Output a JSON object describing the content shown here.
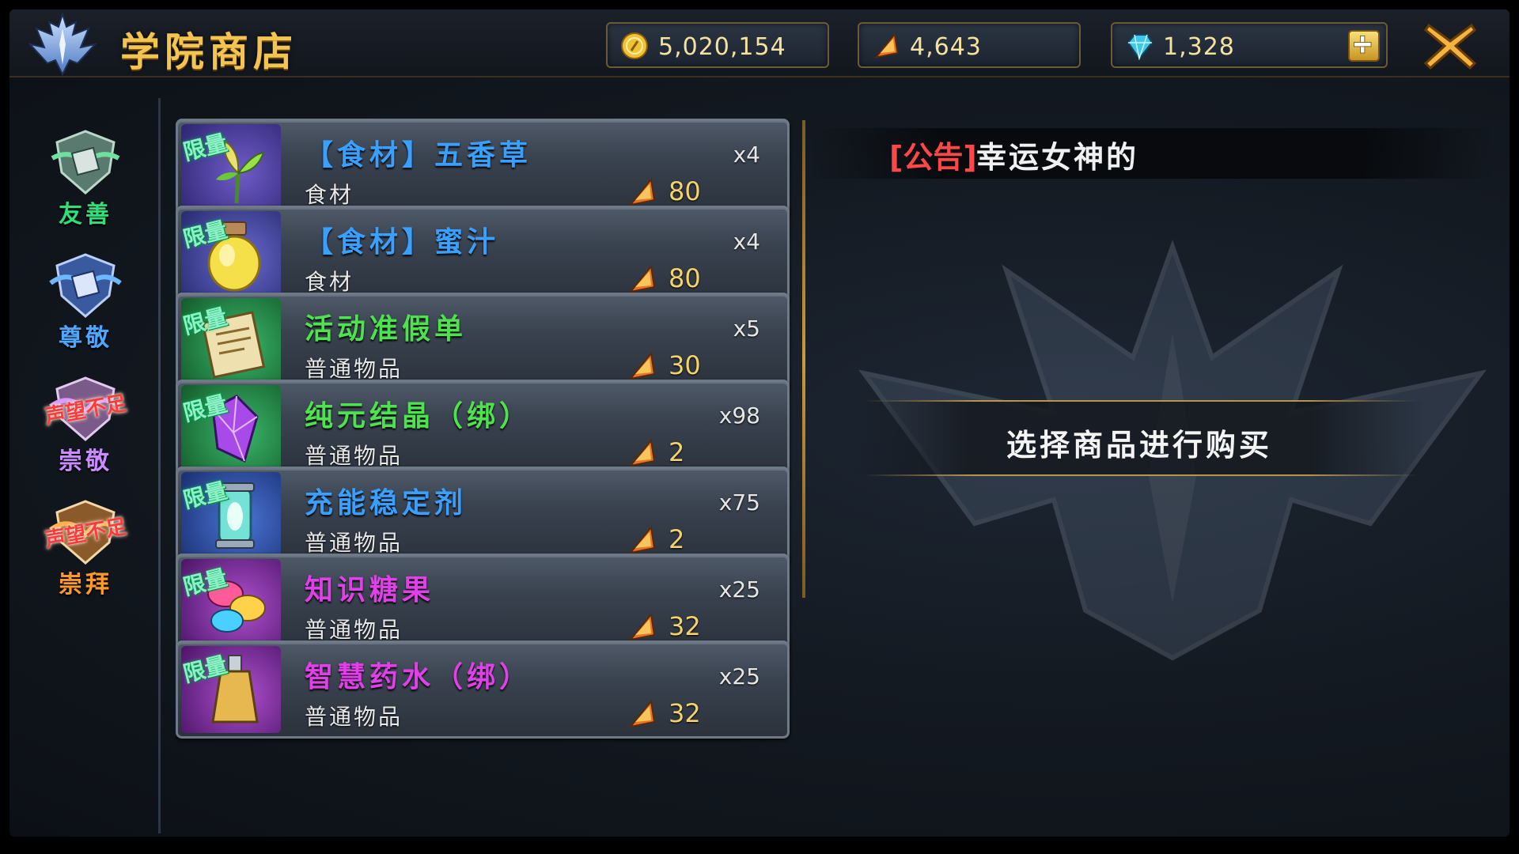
{
  "header": {
    "title": "学院商店",
    "currencies": {
      "gold": "5,020,154",
      "token": "4,643",
      "diamond": "1,328"
    }
  },
  "tabs": [
    {
      "label": "友善",
      "warning": "",
      "color": "#2ee07a"
    },
    {
      "label": "尊敬",
      "warning": "",
      "color": "#4fa6ff"
    },
    {
      "label": "崇敬",
      "warning": "声望不足",
      "color": "#c98bff"
    },
    {
      "label": "崇拜",
      "warning": "声望不足",
      "color": "#ff9a2a"
    }
  ],
  "limit_badge": "限量",
  "items": [
    {
      "name": "【食材】五香草",
      "qty": "x4",
      "category": "食材",
      "price": "80",
      "name_color": "#3aa0ff",
      "icon": "herb-icon"
    },
    {
      "name": "【食材】蜜汁",
      "qty": "x4",
      "category": "食材",
      "price": "80",
      "name_color": "#3aa0ff",
      "icon": "honey-jar-icon"
    },
    {
      "name": "活动准假单",
      "qty": "x5",
      "category": "普通物品",
      "price": "30",
      "name_color": "#4ee24e",
      "icon": "scroll-icon"
    },
    {
      "name": "纯元结晶（绑）",
      "qty": "x98",
      "category": "普通物品",
      "price": "2",
      "name_color": "#4ee24e",
      "icon": "crystal-icon"
    },
    {
      "name": "充能稳定剂",
      "qty": "x75",
      "category": "普通物品",
      "price": "2",
      "name_color": "#3aa0ff",
      "icon": "lantern-icon"
    },
    {
      "name": "知识糖果",
      "qty": "x25",
      "category": "普通物品",
      "price": "32",
      "name_color": "#e040e8",
      "icon": "candy-icon"
    },
    {
      "name": "智慧药水（绑）",
      "qty": "x25",
      "category": "普通物品",
      "price": "32",
      "name_color": "#e040e8",
      "icon": "potion-icon"
    }
  ],
  "announcement": {
    "tag": "[公告]",
    "text": "幸运女神的"
  },
  "detail": {
    "hint": "选择商品进行购买"
  }
}
